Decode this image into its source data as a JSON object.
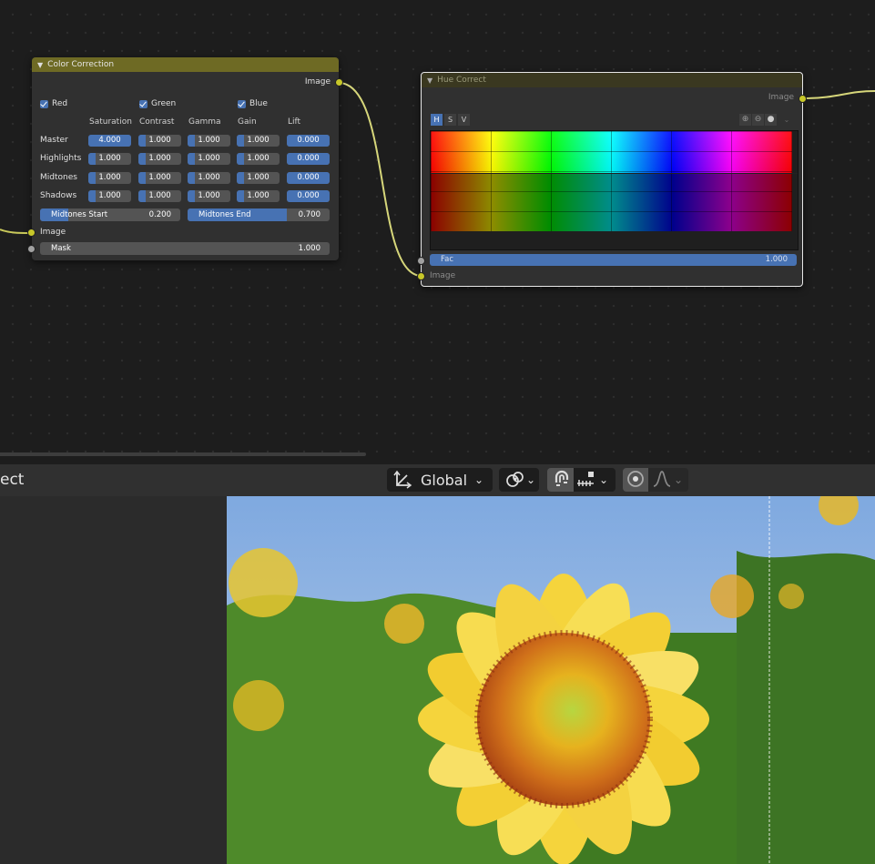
{
  "color_correction": {
    "title": "Color Correction",
    "output_label": "Image",
    "checkboxes": {
      "red": "Red",
      "green": "Green",
      "blue": "Blue"
    },
    "columns": [
      "Saturation",
      "Contrast",
      "Gamma",
      "Gain",
      "Lift"
    ],
    "rows": [
      {
        "label": "Master",
        "values": [
          "4.000",
          "1.000",
          "1.000",
          "1.000",
          "0.000"
        ]
      },
      {
        "label": "Highlights",
        "values": [
          "1.000",
          "1.000",
          "1.000",
          "1.000",
          "0.000"
        ]
      },
      {
        "label": "Midtones",
        "values": [
          "1.000",
          "1.000",
          "1.000",
          "1.000",
          "0.000"
        ]
      },
      {
        "label": "Shadows",
        "values": [
          "1.000",
          "1.000",
          "1.000",
          "1.000",
          "0.000"
        ]
      }
    ],
    "midtones_start": {
      "label": "Midtones Start",
      "value": "0.200"
    },
    "midtones_end": {
      "label": "Midtones End",
      "value": "0.700"
    },
    "input_image": "Image",
    "mask": {
      "label": "Mask",
      "value": "1.000"
    }
  },
  "hue_correct": {
    "title": "Hue Correct",
    "output_label": "Image",
    "modes": [
      "H",
      "S",
      "V"
    ],
    "fac": {
      "label": "Fac",
      "value": "1.000"
    },
    "input_image": "Image"
  },
  "header": {
    "editor_label_fragment": "ect",
    "transform_orientation": "Global"
  },
  "colors": {
    "accent": "#4772b3",
    "node_header": "#6e6a24",
    "socket": "#c7c729"
  },
  "icons": [
    "chevron-down-icon",
    "zoom-in-icon",
    "zoom-out-icon",
    "clipping-icon",
    "transform-orientation-icon",
    "pivot-icon",
    "snap-icon",
    "snap-increment-icon",
    "proportional-edit-icon",
    "falloff-icon"
  ]
}
